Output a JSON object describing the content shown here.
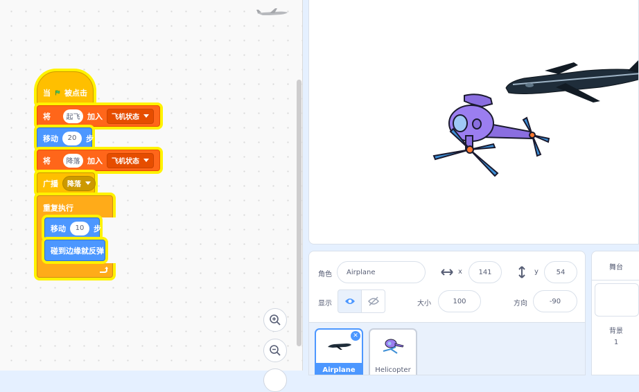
{
  "workspace": {
    "blocks": {
      "when_flag_pre": "当",
      "when_flag_post": "被点击",
      "add1_prefix": "将",
      "add1_item": "起飞",
      "add1_mid": "加入",
      "add1_list": "飞机状态",
      "move1_label": "移动",
      "move1_steps": "20",
      "move1_unit": "步",
      "add2_prefix": "将",
      "add2_item": "降落",
      "add2_mid": "加入",
      "add2_list": "飞机状态",
      "broadcast_label": "广播",
      "broadcast_msg": "降落",
      "forever_label": "重复执行",
      "move2_label": "移动",
      "move2_steps": "10",
      "move2_unit": "步",
      "bounce_label": "碰到边缘就反弹"
    },
    "zoom_in_icon": "zoom-in-icon",
    "zoom_out_icon": "zoom-out-icon"
  },
  "sprite_info": {
    "sprite_label": "角色",
    "sprite_name": "Airplane",
    "x_label": "x",
    "x_value": "141",
    "y_label": "y",
    "y_value": "54",
    "show_label": "显示",
    "size_label": "大小",
    "size_value": "100",
    "direction_label": "方向",
    "direction_value": "-90"
  },
  "sprites": [
    {
      "name": "Airplane",
      "selected": true
    },
    {
      "name": "Helicopter",
      "selected": false
    }
  ],
  "stage_panel": {
    "title": "舞台",
    "backdrop_label": "背景",
    "backdrop_count": "1"
  },
  "colors": {
    "events": "#ffbf00",
    "data": "#ff661a",
    "motion": "#4c97ff",
    "control": "#ffab19",
    "highlight": "#fff200"
  }
}
